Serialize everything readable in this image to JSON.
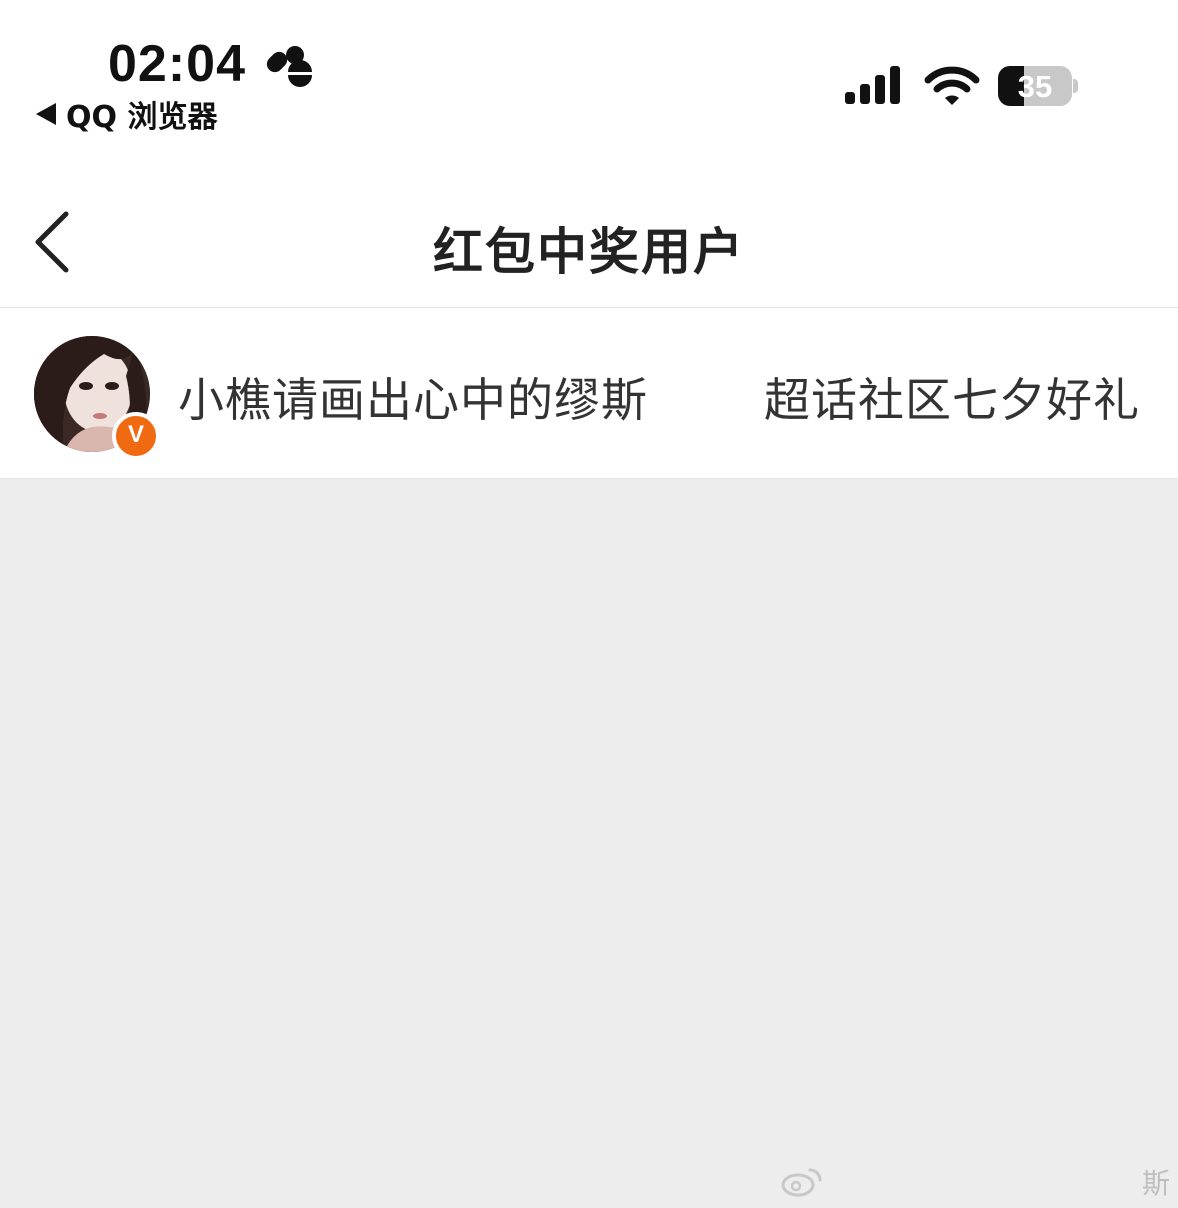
{
  "status_bar": {
    "time": "02:04",
    "back_app_label": "QQ 浏览器",
    "battery_level": "35",
    "battery_percent": 35,
    "icons": [
      "focus-mode-icon",
      "signal-icon",
      "wifi-icon",
      "battery-icon"
    ]
  },
  "nav": {
    "back_icon": "chevron-left-icon",
    "title": "红包中奖用户"
  },
  "winners": [
    {
      "username": "小樵请画出心中的缪斯",
      "prize": "超话社区七夕好礼",
      "verified_badge": "V",
      "badge_color": "#f06a12"
    }
  ],
  "watermark": {
    "logo_icon": "weibo-logo-icon",
    "text_visible": "斯"
  },
  "colors": {
    "page_background": "#ededed",
    "surface": "#ffffff",
    "accent_badge": "#f06a12",
    "text_primary": "#333333"
  }
}
